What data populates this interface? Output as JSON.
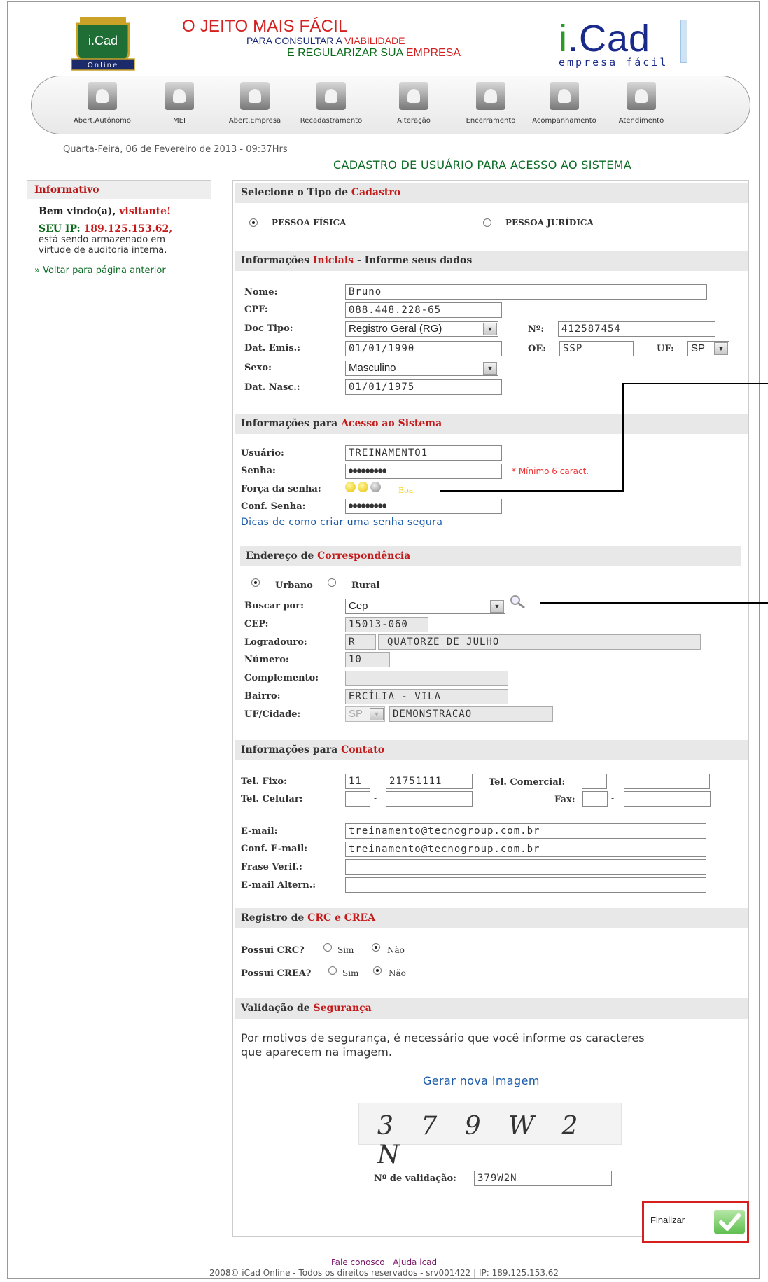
{
  "header": {
    "logo_text": "i.Cad",
    "logo_sub": "Online",
    "tagline1": "O JEITO MAIS FÁCIL",
    "tagline2_a": "PARA CONSULTAR A",
    "tagline2_b": "VIABILIDADE",
    "tagline3_a": "E REGULARIZAR SUA",
    "tagline3_b": "EMPRESA",
    "brand": "iCad",
    "brand_sub": "empresa fácil",
    "brand_vert": "Online"
  },
  "toolbar": [
    {
      "label": "Abert.Autônomo",
      "icon": "person-icon"
    },
    {
      "label": "MEI",
      "icon": "person-desk-icon"
    },
    {
      "label": "Abert.Empresa",
      "icon": "group-icon"
    },
    {
      "label": "Recadastramento",
      "icon": "person-gear-icon"
    },
    {
      "label": "Alteração",
      "icon": "document-icon"
    },
    {
      "label": "Encerramento",
      "icon": "cancel-icon"
    },
    {
      "label": "Acompanhamento",
      "icon": "binoculars-icon"
    },
    {
      "label": "Atendimento",
      "icon": "attendant-icon"
    }
  ],
  "date": "Quarta-Feira, 06 de Fevereiro de 2013 - 09:37Hrs",
  "page_title": "CADASTRO DE USUÁRIO PARA ACESSO AO SISTEMA",
  "sidebar": {
    "heading": "Informativo",
    "welcome_a": "Bem vindo(a),",
    "welcome_b": "visitante!",
    "ip_a": "SEU IP:",
    "ip_b": "189.125.153.62,",
    "ip_text1": "está sendo armazenado em",
    "ip_text2": "virtude de auditoria interna.",
    "back_link": "» Voltar para página anterior"
  },
  "tipo": {
    "heading_a": "Selecione o Tipo de",
    "heading_b": "Cadastro",
    "opt1": "PESSOA FÍSICA",
    "opt2": "PESSOA JURÍDICA",
    "selected": "PESSOA FÍSICA"
  },
  "iniciais": {
    "heading_a": "Informações",
    "heading_b": "Iniciais",
    "heading_c": "- Informe seus dados",
    "nome_label": "Nome:",
    "nome": "Bruno",
    "cpf_label": "CPF:",
    "cpf": "088.448.228-65",
    "doc_tipo_label": "Doc Tipo:",
    "doc_tipo": "Registro Geral (RG)",
    "num_label": "Nº:",
    "num": "412587454",
    "emis_label": "Dat. Emis.:",
    "emis": "01/01/1990",
    "oe_label": "OE:",
    "oe": "SSP",
    "uf_label": "UF:",
    "uf": "SP",
    "sexo_label": "Sexo:",
    "sexo": "Masculino",
    "nasc_label": "Dat. Nasc.:",
    "nasc": "01/01/1975"
  },
  "acesso": {
    "heading_a": "Informações para",
    "heading_b": "Acesso ao Sistema",
    "usuario_label": "Usuário:",
    "usuario": "TREINAMENTO1",
    "senha_label": "Senha:",
    "senha": "●●●●●●●●●",
    "senha_req": "* Mínimo 6 caract.",
    "forca_label": "Força da senha:",
    "forca": "Boa",
    "forca_level": 2,
    "conf_label": "Conf. Senha:",
    "conf": "●●●●●●●●●",
    "dicas": "Dicas de como criar uma senha segura"
  },
  "endereco": {
    "heading_a": "Endereço de",
    "heading_b": "Correspondência",
    "urbano": "Urbano",
    "rural": "Rural",
    "buscar_label": "Buscar por:",
    "buscar": "Cep",
    "cep_label": "CEP:",
    "cep": "15013-060",
    "logr_label": "Logradouro:",
    "logr_tipo": "R",
    "logr": "QUATORZE DE JULHO",
    "numero_label": "Número:",
    "numero": "10",
    "compl_label": "Complemento:",
    "compl": "",
    "bairro_label": "Bairro:",
    "bairro": "ERCÍLIA - VILA",
    "ufcid_label": "UF/Cidade:",
    "uf": "SP",
    "cidade": "DEMONSTRACAO"
  },
  "contato": {
    "heading_a": "Informações para",
    "heading_b": "Contato",
    "fixo_label": "Tel. Fixo:",
    "fixo_ddd": "11",
    "fixo": "21751111",
    "com_label": "Tel. Comercial:",
    "cel_label": "Tel. Celular:",
    "fax_label": "Fax:",
    "email_label": "E-mail:",
    "email": "treinamento@tecnogroup.com.br",
    "conf_email_label": "Conf. E-mail:",
    "conf_email": "treinamento@tecnogroup.com.br",
    "frase_label": "Frase Verif.:",
    "altern_label": "E-mail Altern.:"
  },
  "registro": {
    "heading_a": "Registro de",
    "heading_b": "CRC e CREA",
    "crc_label": "Possui CRC?",
    "crea_label": "Possui CREA?",
    "sim": "Sim",
    "nao": "Não"
  },
  "validacao": {
    "heading_a": "Validação de",
    "heading_b": "Segurança",
    "msg1": "Por motivos de segurança, é necessário que você informe os caracteres",
    "msg2": "que aparecem na imagem.",
    "gerar": "Gerar nova imagem",
    "captcha": "3 7 9 W 2 N",
    "num_label": "Nº de validação:",
    "num": "379W2N",
    "finalizar": "Finalizar"
  },
  "footer": {
    "line1": "Fale conosco | Ajuda icad",
    "line2": "2008© iCad Online - Todos os direitos reservados - srv001422 | IP: 189.125.153.62"
  },
  "colors": {
    "red": "#c41a1a",
    "green": "#0b6b24",
    "blue": "#1a2a8a",
    "yellow": "#f2d21a"
  }
}
